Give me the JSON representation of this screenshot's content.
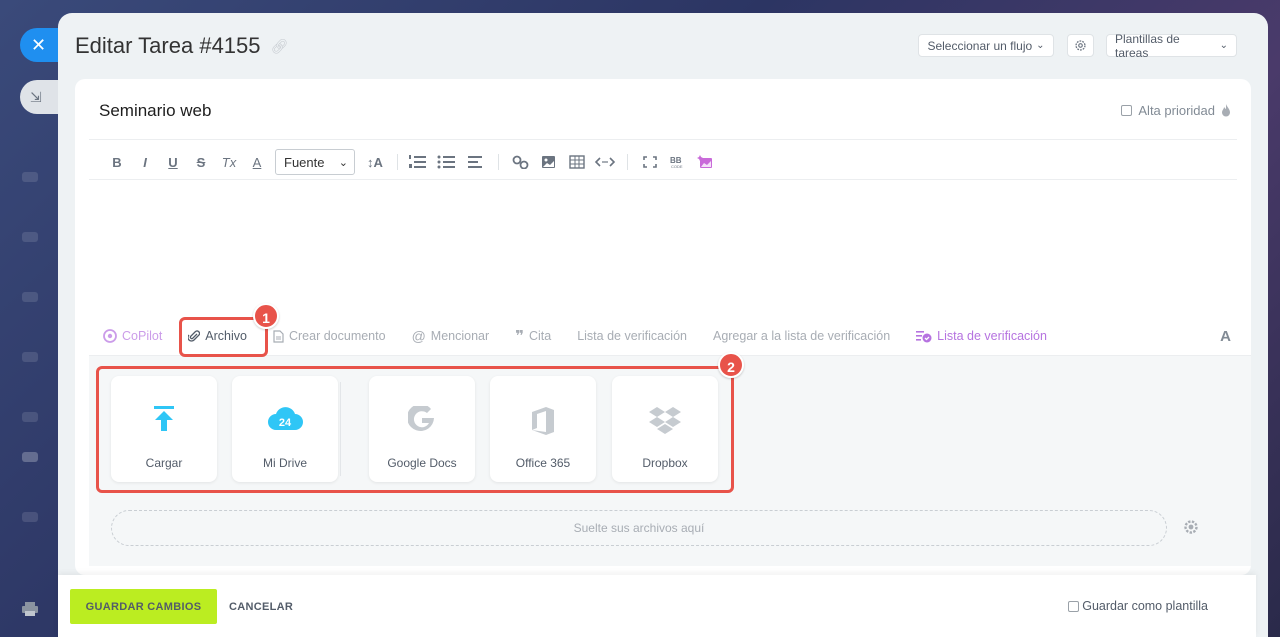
{
  "header": {
    "title": "Editar Tarea #4155",
    "flow_select": "Seleccionar un flujo",
    "templates": "Plantillas de tareas"
  },
  "task": {
    "name": "Seminario web",
    "high_priority": "Alta prioridad"
  },
  "toolbar": {
    "bold": "B",
    "italic": "I",
    "underline": "U",
    "strike": "S",
    "clear": "Tx",
    "color": "A",
    "font_select": "Fuente",
    "size": "↕A"
  },
  "actions": {
    "copilot": "CoPilot",
    "file": "Archivo",
    "create_doc": "Crear documento",
    "mention": "Mencionar",
    "quote": "Cita",
    "checklist": "Lista de verificación",
    "add_checklist": "Agregar a la lista de verificación",
    "checklist2": "Lista de verificación",
    "font_a": "A"
  },
  "uploads": {
    "items": [
      {
        "label": "Cargar"
      },
      {
        "label": "Mi Drive",
        "badge": "24"
      },
      {
        "label": "Google Docs"
      },
      {
        "label": "Office 365"
      },
      {
        "label": "Dropbox"
      }
    ],
    "drop_text": "Suelte sus archivos aquí"
  },
  "annotations": {
    "badge1": "1",
    "badge2": "2",
    "color": "#e8534a"
  },
  "footer": {
    "save": "GUARDAR CAMBIOS",
    "cancel": "CANCELAR",
    "save_template": "Guardar como plantilla"
  },
  "colors": {
    "accent_blue": "#1f8ff0",
    "save_green": "#bbed21",
    "copilot_purple": "#b673e0"
  }
}
